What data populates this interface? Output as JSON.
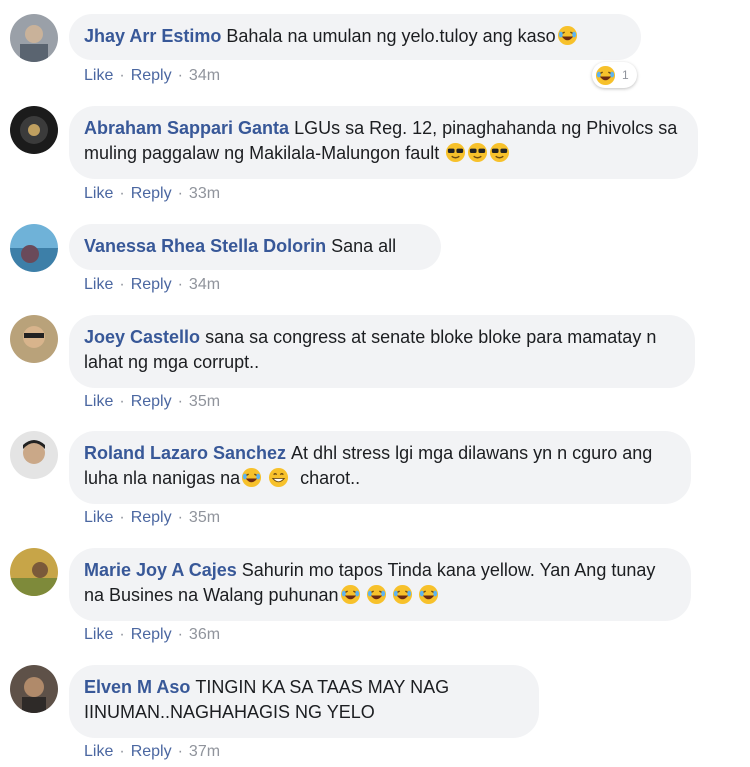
{
  "comments": [
    {
      "author": "Jhay Arr Estimo",
      "text": "Bahala na umulan ng yelo.tuloy ang kaso",
      "emojis": [
        "laughing-crying"
      ],
      "like": "Like",
      "reply": "Reply",
      "time": "34m",
      "reaction": {
        "emoji": "laughing-crying",
        "count": "1"
      }
    },
    {
      "author": "Abraham Sappari Ganta",
      "text": "LGUs sa Reg. 12, pinaghahanda ng Phivolcs sa muling paggalaw ng Makilala-Malungon fault",
      "emojis": [
        "sunglasses",
        "sunglasses",
        "sunglasses"
      ],
      "like": "Like",
      "reply": "Reply",
      "time": "33m"
    },
    {
      "author": "Vanessa Rhea Stella Dolorin",
      "text": "Sana all",
      "emojis": [],
      "like": "Like",
      "reply": "Reply",
      "time": "34m"
    },
    {
      "author": "Joey Castello",
      "text": "sana sa congress at senate bloke bloke para mamatay n lahat ng mga corrupt..",
      "emojis": [],
      "like": "Like",
      "reply": "Reply",
      "time": "35m"
    },
    {
      "author": "Roland Lazaro Sanchez",
      "text": "At dhl stress lgi mga dilawans yn n cguro ang luha nla nanigas na",
      "emojis": [
        "laughing-crying",
        "grinning"
      ],
      "suffix": "charot..",
      "like": "Like",
      "reply": "Reply",
      "time": "35m"
    },
    {
      "author": "Marie Joy A Cajes",
      "text": "Sahurin mo tapos Tinda kana yellow. Yan Ang tunay na Busines na Walang puhunan",
      "emojis": [
        "laughing-crying",
        "laughing-crying",
        "laughing-crying",
        "laughing-crying"
      ],
      "like": "Like",
      "reply": "Reply",
      "time": "36m"
    },
    {
      "author": "Elven M Aso",
      "text": "TINGIN KA SA TAAS MAY NAG IINUMAN..NAGHAHAGIS NG YELO",
      "emojis": [],
      "like": "Like",
      "reply": "Reply",
      "time": "37m"
    }
  ],
  "separator": "·",
  "colors": {
    "author": "#385898",
    "bubble": "#f2f3f5",
    "link": "#4b67a1",
    "meta": "#90949c"
  }
}
